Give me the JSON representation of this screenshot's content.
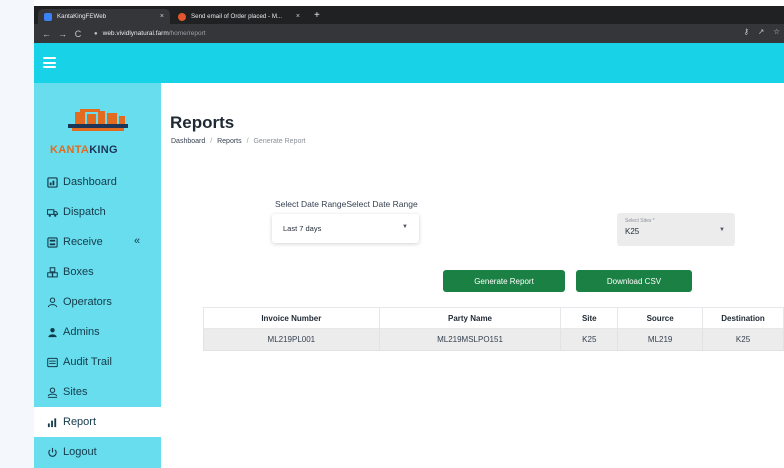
{
  "browser": {
    "tabs": [
      {
        "label": "KantaKingFEWeb",
        "close": "×"
      },
      {
        "label": "Send email of Order placed - M...",
        "close": "×"
      }
    ],
    "new_tab": "+",
    "url_host": "web.vividlynatural.farm",
    "url_path": "/home/report",
    "nav": {
      "back": "←",
      "forward": "→",
      "reload": "C"
    }
  },
  "app": {
    "logo": {
      "part1": "KANTA",
      "part2": "KING"
    },
    "colors": {
      "header": "#18d3e7",
      "sidebar": "#68dded",
      "primary_button": "#1b8043"
    }
  },
  "sidebar": {
    "items": [
      {
        "label": "Dashboard",
        "icon": "dashboard-icon"
      },
      {
        "label": "Dispatch",
        "icon": "truck-icon"
      },
      {
        "label": "Receive",
        "icon": "receive-icon",
        "chevron": "«"
      },
      {
        "label": "Boxes",
        "icon": "boxes-icon"
      },
      {
        "label": "Operators",
        "icon": "person-icon"
      },
      {
        "label": "Admins",
        "icon": "admin-icon"
      },
      {
        "label": "Audit Trail",
        "icon": "audit-icon"
      },
      {
        "label": "Sites",
        "icon": "sites-icon"
      },
      {
        "label": "Report",
        "icon": "chart-icon",
        "active": true
      },
      {
        "label": "Logout",
        "icon": "power-icon"
      }
    ]
  },
  "page": {
    "title": "Reports",
    "breadcrumb": {
      "first": "Dashboard",
      "second": "Reports",
      "current": "Generate Report",
      "separator": "/"
    }
  },
  "filters": {
    "date_label": "Select Date RangeSelect Date Range",
    "date_value": "Last 7 days",
    "site_label": "Select Sites *",
    "site_value": "K25"
  },
  "buttons": {
    "generate": "Generate Report",
    "download": "Download CSV"
  },
  "table": {
    "columns": [
      "Invoice Number",
      "Party Name",
      "Site",
      "Source",
      "Destination"
    ],
    "rows": [
      [
        "ML219PL001",
        "ML219MSLPO151",
        "K25",
        "ML219",
        "K25"
      ]
    ]
  }
}
